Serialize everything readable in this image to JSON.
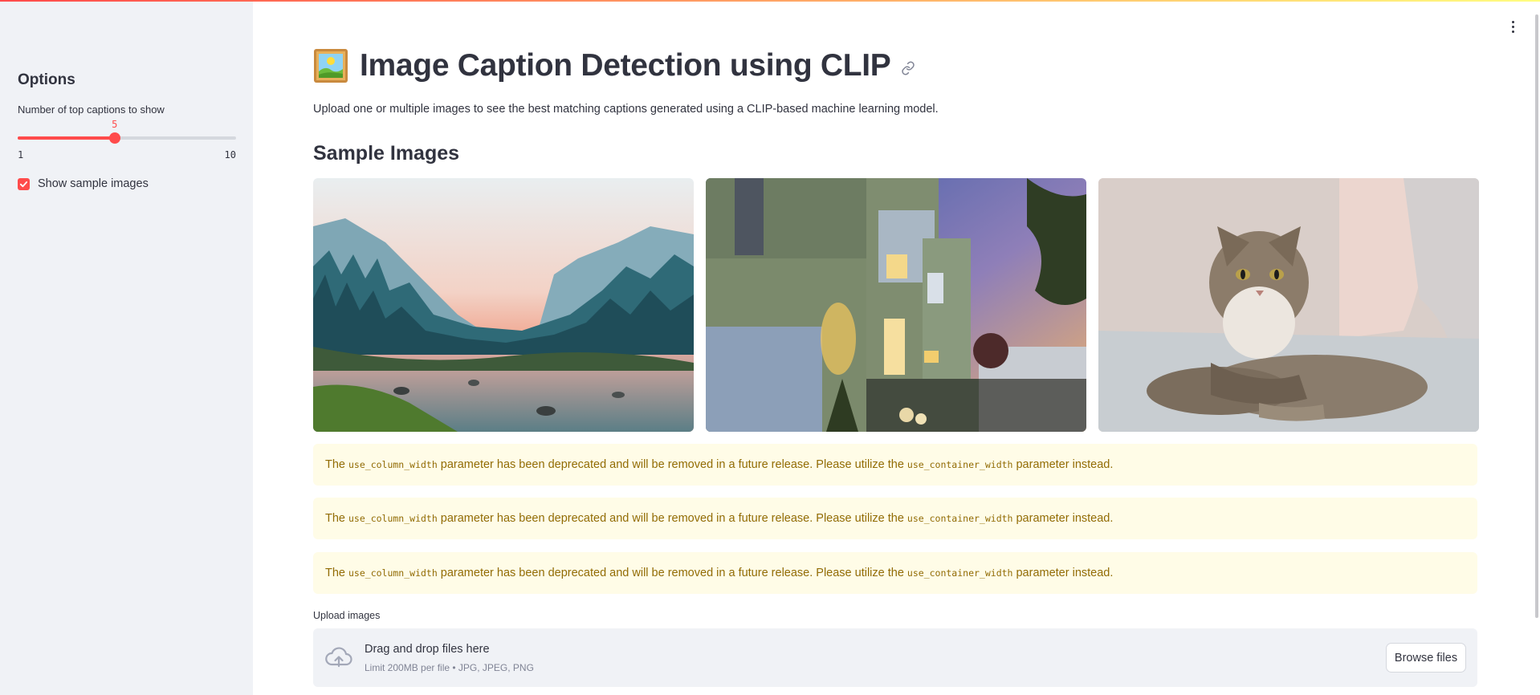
{
  "sidebar": {
    "title": "Options",
    "slider": {
      "label": "Number of top captions to show",
      "value": "5",
      "min": "1",
      "max": "10",
      "fraction": 0.444
    },
    "checkbox": {
      "label": "Show sample images",
      "checked": true
    }
  },
  "main": {
    "title": "Image Caption Detection using CLIP",
    "title_icon": "framed-picture-icon",
    "subtitle": "Upload one or multiple images to see the best matching captions generated using a CLIP-based machine learning model.",
    "sample_header": "Sample Images",
    "sample_images": [
      "mountain-river-landscape",
      "modern-house-at-dusk",
      "tabby-cat-on-couch"
    ],
    "warnings": [
      {
        "prefix": "The",
        "code1": "use_column_width",
        "middle": "parameter has been deprecated and will be removed in a future release. Please utilize the",
        "code2": "use_container_width",
        "suffix": "parameter instead."
      },
      {
        "prefix": "The",
        "code1": "use_column_width",
        "middle": "parameter has been deprecated and will be removed in a future release. Please utilize the",
        "code2": "use_container_width",
        "suffix": "parameter instead."
      },
      {
        "prefix": "The",
        "code1": "use_column_width",
        "middle": "parameter has been deprecated and will be removed in a future release. Please utilize the",
        "code2": "use_container_width",
        "suffix": "parameter instead."
      }
    ],
    "uploader": {
      "label": "Upload images",
      "drop_title": "Drag and drop files here",
      "drop_limit": "Limit 200MB per file • JPG, JPEG, PNG",
      "browse_label": "Browse files"
    }
  },
  "colors": {
    "accent": "#ff4b4b",
    "sidebar_bg": "#f0f2f6",
    "warning_bg": "#fffce7",
    "warning_text": "#926c05",
    "text": "#31333f"
  }
}
